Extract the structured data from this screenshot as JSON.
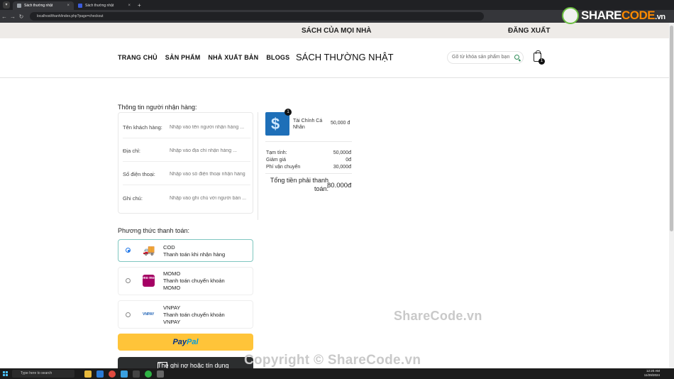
{
  "browser": {
    "tabs": [
      {
        "title": "Sách thường nhật",
        "active": true
      },
      {
        "title": "Sách thường nhật",
        "active": false
      }
    ],
    "url": "localhost/thanh/index.php?page=checkout"
  },
  "site": {
    "slogan": "SÁCH CỦA MỌI NHÀ",
    "logout": "ĐĂNG XUẤT",
    "nav": [
      "TRANG CHỦ",
      "SẢN PHẨM",
      "NHÀ XUẤT BẢN",
      "BLOGS"
    ],
    "brand": "SÁCH THƯỜNG NHẬT",
    "search_placeholder": "Gõ từ khóa sản phẩm bạn",
    "cart_count": "1"
  },
  "recipient": {
    "title": "Thông tin người nhận hàng:",
    "fields": [
      {
        "label": "Tên khách hàng:",
        "placeholder": "Nhập vào tên người nhận hàng ..."
      },
      {
        "label": "Địa chỉ:",
        "placeholder": "Nhập vào địa chỉ nhận hàng ..."
      },
      {
        "label": "Số điện thoại:",
        "placeholder": "Nhập vào số điện thoại nhận hàng"
      },
      {
        "label": "Ghi chú:",
        "placeholder": "Nhập vào ghi chú với người bán ..."
      }
    ]
  },
  "order": {
    "item": {
      "name": "Tài Chính Cá Nhân",
      "price": "50,000 đ",
      "qty": "1"
    },
    "subtotal_label": "Tạm tính:",
    "subtotal": "50,000đ",
    "discount_label": "Giảm giá",
    "discount": "0đ",
    "shipping_label": "Phí vận chuyển",
    "shipping": "30,000đ",
    "total_label": "Tổng tiền phải thanh toán:",
    "total": "80.000đ"
  },
  "payment": {
    "title": "Phương thức thanh toán:",
    "methods": [
      {
        "name": "COD",
        "desc": "Thanh toán khi nhận hàng",
        "selected": true
      },
      {
        "name": "MOMO",
        "desc": "Thanh toán chuyển khoản",
        "desc2": "MOMO",
        "icon_text": "mo mo"
      },
      {
        "name": "VNPAY",
        "desc": "Thanh toán chuyển khoản",
        "desc2": "VNPAY",
        "icon_text": "VNPAY"
      }
    ],
    "paypal_a": "Pay",
    "paypal_b": "Pal",
    "card_label": "Thẻ ghi nợ hoặc tín dụng"
  },
  "watermark": {
    "logo_share": "SHARE",
    "logo_code": "CODE",
    "logo_vn": ".vn",
    "center": "ShareCode.vn",
    "copyright": "Copyright © ShareCode.vn"
  },
  "taskbar": {
    "search": "Type here to search",
    "time": "12:20 AM",
    "date": "11/29/2024"
  },
  "colors": {
    "accent": "#2e8b57",
    "paypal": "#ffc439",
    "momo": "#a50064",
    "selected_border": "#7fc7c0"
  }
}
